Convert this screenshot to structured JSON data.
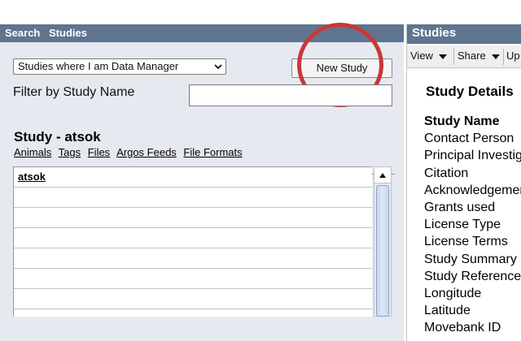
{
  "nav": {
    "search": "Search",
    "studies": "Studies"
  },
  "controls": {
    "study_filter_selected": "Studies where I am Data Manager",
    "new_study_label": "New Study",
    "filter_label": "Filter by Study Name",
    "filter_value": ""
  },
  "study": {
    "heading": "Study - atsok",
    "links": [
      "Animals",
      "Tags",
      "Files",
      "Argos Feeds",
      "File Formats"
    ]
  },
  "list": {
    "rows": [
      "atsok",
      "",
      "",
      "",
      "",
      "",
      "",
      ""
    ]
  },
  "right_panel": {
    "title": "Studies",
    "toolbar": {
      "view": "View",
      "share": "Share",
      "up": "Up"
    },
    "details_title": "Study Details",
    "fields": [
      "Study Name",
      "Contact Person",
      "Principal Investigator",
      "Citation",
      "Acknowledgements",
      "Grants used",
      "License Type",
      "License Terms",
      "Study Summary",
      "Study Reference",
      "Longitude",
      "Latitude",
      "Movebank ID"
    ]
  },
  "colors": {
    "header_bar": "#5f7590",
    "panel_bg": "#e6e9ef",
    "highlight_circle": "#c9373a"
  }
}
